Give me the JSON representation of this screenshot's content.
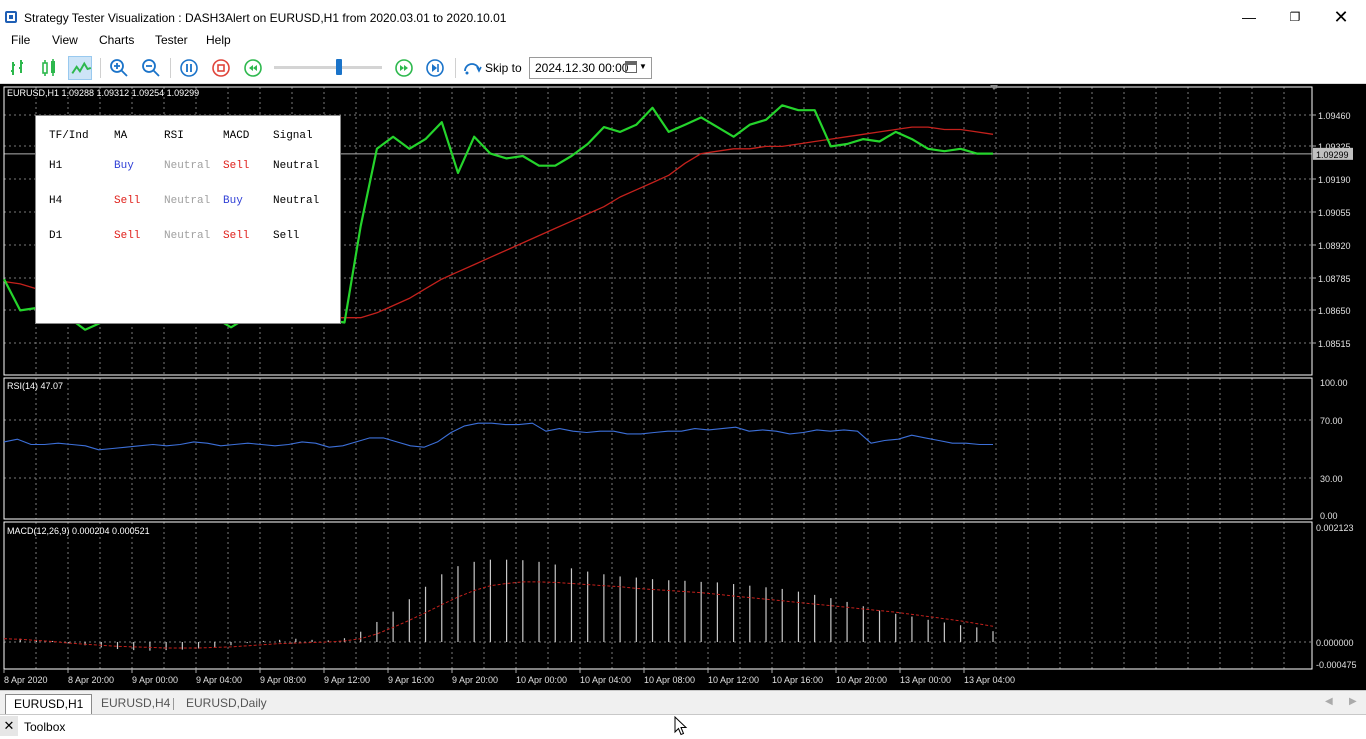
{
  "window": {
    "title": "Strategy Tester Visualization : DASH3Alert on EURUSD,H1 from 2020.03.01 to 2020.10.01",
    "controls": {
      "minimize": "—",
      "maximize": "❐",
      "close": "✕"
    }
  },
  "menu": [
    "File",
    "View",
    "Charts",
    "Tester",
    "Help"
  ],
  "toolbar": {
    "buttons": [
      "bar-chart-icon",
      "candlestick-icon",
      "line-chart-icon",
      "zoom-in-icon",
      "zoom-out-icon",
      "pause-icon",
      "stop-icon",
      "rewind-icon",
      "fast-forward-icon",
      "step-forward-icon",
      "skip-to-icon"
    ],
    "speed_level": 0.6,
    "skip_to_label": "Skip to",
    "skip_to_value": "2024.12.30 00:00",
    "colors": {
      "green": "#2db84d",
      "blue": "#1a73c9",
      "red": "#e0443a"
    }
  },
  "main_chart": {
    "info": "EURUSD,H1 1.09288 1.09312 1.09254 1.09299",
    "price_labels": [
      "1.09460",
      "1.09325",
      "1.09190",
      "1.09055",
      "1.08920",
      "1.08785",
      "1.08650",
      "1.08515"
    ],
    "current_price": "1.09299",
    "colors": {
      "price_line": "#25d42c",
      "ma_line": "#c4211c",
      "grid": "#7a7a7a",
      "current_tag_bg": "#c0c0c0"
    }
  },
  "dashboard": {
    "headers": [
      "TF/Ind",
      "MA",
      "RSI",
      "MACD",
      "Signal"
    ],
    "rows": [
      {
        "tf": "H1",
        "ma": "Buy",
        "rsi": "Neutral",
        "macd": "Sell",
        "signal": "Neutral"
      },
      {
        "tf": "H4",
        "ma": "Sell",
        "rsi": "Neutral",
        "macd": "Buy",
        "signal": "Neutral"
      },
      {
        "tf": "D1",
        "ma": "Sell",
        "rsi": "Neutral",
        "macd": "Sell",
        "signal": "Sell"
      }
    ],
    "colors": {
      "Buy": "#2f3fd6",
      "Sell": "#e0211c",
      "Neutral": "#a0a0a0",
      "default": "#000000"
    }
  },
  "rsi_panel": {
    "info": "RSI(14) 47.07",
    "labels": [
      "100.00",
      "70.00",
      "30.00",
      "0.00"
    ],
    "color": "#3c6fd8"
  },
  "macd_panel": {
    "info": "MACD(12,26,9) 0.000204 0.000521",
    "labels": [
      "0.002123",
      "0.000000",
      "-0.000475"
    ],
    "colors": {
      "histogram": "#c8c8c8",
      "signal": "#c4211c"
    }
  },
  "time_axis": [
    "8 Apr 2020",
    "8 Apr 20:00",
    "9 Apr 00:00",
    "9 Apr 04:00",
    "9 Apr 08:00",
    "9 Apr 12:00",
    "9 Apr 16:00",
    "9 Apr 20:00",
    "10 Apr 00:00",
    "10 Apr 04:00",
    "10 Apr 08:00",
    "10 Apr 12:00",
    "10 Apr 16:00",
    "10 Apr 20:00",
    "13 Apr 00:00",
    "13 Apr 04:00"
  ],
  "chart_tabs": [
    {
      "label": "EURUSD,H1",
      "active": true
    },
    {
      "label": "EURUSD,H4",
      "active": false
    },
    {
      "label": "EURUSD,Daily",
      "active": false
    }
  ],
  "toolbox": {
    "close": "✕",
    "label": "Toolbox"
  },
  "chart_data": [
    {
      "type": "line",
      "name": "price",
      "ylim": [
        1.0845,
        1.0965
      ],
      "series": [
        {
          "values": [
            1.0878,
            1.0865,
            1.0866,
            1.0864,
            1.0862,
            1.0857,
            1.086,
            1.086,
            1.0862,
            1.0862,
            1.0862,
            1.0861,
            1.0863,
            1.0862,
            1.0858,
            1.0862,
            1.0865,
            1.0863,
            1.0862,
            1.0861,
            1.0861,
            1.086,
            1.09,
            1.0932,
            1.0937,
            1.0932,
            1.0936,
            1.0943,
            1.0922,
            1.0937,
            1.093,
            1.0928,
            1.0929,
            1.0925,
            1.0925,
            1.0929,
            1.0934,
            1.0941,
            1.0939,
            1.0942,
            1.0949,
            1.0939,
            1.0942,
            1.0945,
            1.0941,
            1.0937,
            1.0942,
            1.0944,
            1.095,
            1.0948,
            1.0948,
            1.0933,
            1.0934,
            1.0936,
            1.0935,
            1.0939,
            1.0936,
            1.0932,
            1.0931,
            1.0932,
            1.093,
            1.093
          ]
        },
        {
          "values": [
            1.0877,
            1.0876,
            1.0874,
            1.0873,
            1.0871,
            1.0869,
            1.0868,
            1.0866,
            1.0865,
            1.0864,
            1.0863,
            1.0862,
            1.0862,
            1.0862,
            1.0862,
            1.0862,
            1.0862,
            1.0862,
            1.0862,
            1.0862,
            1.0862,
            1.0862,
            1.0862,
            1.0864,
            1.0867,
            1.087,
            1.0874,
            1.0878,
            1.0881,
            1.0884,
            1.0887,
            1.089,
            1.0893,
            1.0896,
            1.0899,
            1.0902,
            1.0905,
            1.0908,
            1.0912,
            1.0915,
            1.0918,
            1.0921,
            1.0926,
            1.093,
            1.0931,
            1.0932,
            1.0932,
            1.0933,
            1.0933,
            1.0934,
            1.0935,
            1.0936,
            1.0937,
            1.0938,
            1.0939,
            1.094,
            1.0941,
            1.0941,
            1.094,
            1.094,
            1.0939,
            1.0938
          ]
        }
      ]
    },
    {
      "type": "line",
      "name": "RSI(14)",
      "ylim": [
        0,
        100
      ],
      "values": [
        55,
        57,
        53,
        53,
        54,
        53,
        52,
        49,
        50,
        51,
        52,
        53,
        52,
        53,
        55,
        54,
        52,
        53,
        54,
        53,
        52,
        53,
        55,
        54,
        51,
        52,
        55,
        58,
        58,
        55,
        52,
        51,
        55,
        62,
        67,
        69,
        69,
        68,
        68,
        69,
        63,
        65,
        63,
        62,
        63,
        63,
        61,
        61,
        62,
        63,
        63,
        65,
        64,
        65,
        66,
        63,
        64,
        63,
        61,
        62,
        64,
        63,
        64,
        63,
        54,
        56,
        57,
        60,
        58,
        56,
        54,
        54,
        53,
        53
      ]
    },
    {
      "type": "bar",
      "name": "MACD(12,26,9)",
      "ylim": [
        -0.000475,
        0.002123
      ],
      "values": [
        8e-05,
        6e-05,
        4e-05,
        2e-05,
        -2e-05,
        -6e-05,
        -0.0001,
        -0.00013,
        -0.00015,
        -0.00016,
        -0.00015,
        -0.00014,
        -0.00012,
        -0.0001,
        -6e-05,
        -2e-05,
        2e-05,
        4e-05,
        6e-05,
        4e-05,
        3e-05,
        7e-05,
        0.00019,
        0.00037,
        0.00056,
        0.00079,
        0.00102,
        0.00125,
        0.0014,
        0.00148,
        0.00152,
        0.00152,
        0.00151,
        0.00148,
        0.00143,
        0.00136,
        0.0013,
        0.00125,
        0.00121,
        0.00119,
        0.00116,
        0.00114,
        0.00113,
        0.00111,
        0.0011,
        0.00107,
        0.00104,
        0.00101,
        0.00098,
        0.00093,
        0.00087,
        0.00081,
        0.00074,
        0.00066,
        0.00058,
        0.00052,
        0.00047,
        0.00041,
        0.00036,
        0.00031,
        0.00027,
        0.0002
      ],
      "signal": [
        6e-05,
        5e-05,
        3e-05,
        1e-05,
        -2e-05,
        -4e-05,
        -6e-05,
        -8e-05,
        -9e-05,
        -0.0001,
        -0.00011,
        -0.00011,
        -0.00011,
        -0.0001,
        -9e-05,
        -7e-05,
        -5e-05,
        -3e-05,
        -2e-05,
        -1e-05,
        0.0,
        2e-05,
        6e-05,
        0.00015,
        0.00027,
        0.0004,
        0.00054,
        0.00069,
        0.00083,
        0.00095,
        0.00104,
        0.00108,
        0.00111,
        0.00111,
        0.0011,
        0.00108,
        0.00106,
        0.00104,
        0.00102,
        0.00099,
        0.00097,
        0.00095,
        0.00093,
        0.00091,
        0.00088,
        0.00085,
        0.00082,
        0.00079,
        0.00076,
        0.00073,
        0.0007,
        0.00067,
        0.00064,
        0.00061,
        0.00058,
        0.00055,
        0.00051,
        0.00047,
        0.00043,
        0.00039,
        0.00034,
        0.00029
      ]
    }
  ]
}
